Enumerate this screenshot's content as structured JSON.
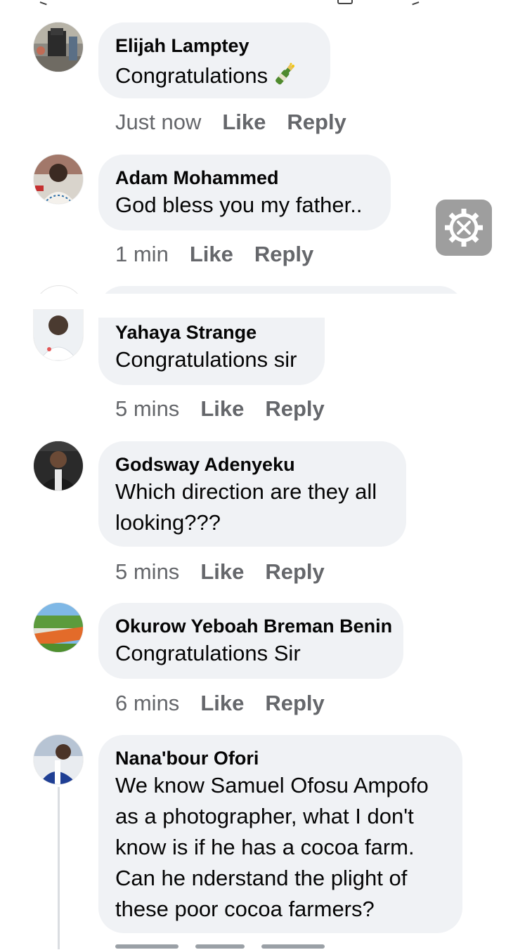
{
  "comments": [
    {
      "name": "Elijah Lamptey",
      "text": "Congratulations",
      "time": "Just now",
      "like": "Like",
      "reply": "Reply",
      "emoji_icon": "champagne-bottle-icon"
    },
    {
      "name": "Adam Mohammed",
      "text": "God bless you my father..",
      "time": "1 min",
      "like": "Like",
      "reply": "Reply"
    },
    {
      "name": "Yahaya Strange",
      "text": "Congratulations sir",
      "time": "5 mins",
      "like": "Like",
      "reply": "Reply"
    },
    {
      "name": "Godsway Adenyeku",
      "text": "Which direction are they all looking???",
      "time": "5 mins",
      "like": "Like",
      "reply": "Reply"
    },
    {
      "name": "Okurow Yeboah Breman Benin",
      "text": "Congratulations Sir",
      "time": "6 mins",
      "like": "Like",
      "reply": "Reply"
    },
    {
      "name": "Nana'bour Ofori",
      "text": "We know Samuel Ofosu Ampofo as a photographer, what I don't know is if he has a cocoa farm. Can he nderstand the plight of these poor cocoa farmers?"
    }
  ],
  "overlay": {
    "icon": "settings-gear-icon"
  },
  "colors": {
    "bubble": "#f0f2f5",
    "meta": "#65676b",
    "text": "#050505",
    "overlay": "#9e9e9e"
  }
}
